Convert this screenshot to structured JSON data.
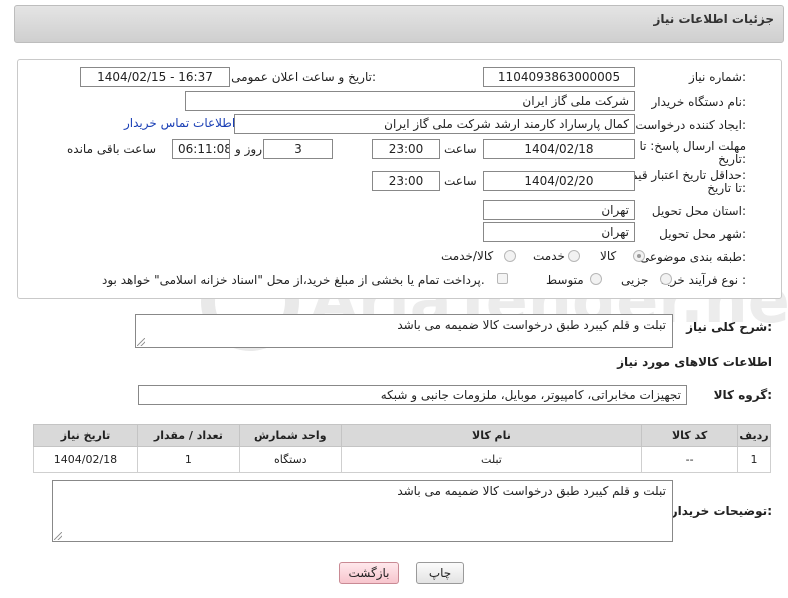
{
  "header": {
    "title": "جزئیات اطلاعات نیاز"
  },
  "form": {
    "need_number_label": "شماره نیاز:",
    "need_number": "1104093863000005",
    "announce_label": "تاریخ و ساعت اعلان عمومی:",
    "announce_value": "1404/02/15 - 16:37",
    "buyer_org_label": "نام دستگاه خریدار:",
    "buyer_org": "شرکت ملی گاز ایران",
    "creator_label": "ایجاد کننده درخواست:",
    "creator": "کمال پارساراد کارمند ارشد شرکت ملی گاز ایران",
    "contact_link": "اطلاعات تماس خریدار",
    "deadline_label_1": "مهلت ارسال پاسخ: تا",
    "deadline_label_2": "تاریخ:",
    "deadline_date": "1404/02/18",
    "time_label": "ساعت",
    "deadline_time": "23:00",
    "days_value": "3",
    "days_label": "روز و",
    "remaining_time": "06:11:08",
    "remaining_label": "ساعت باقی مانده",
    "price_label_1": "حداقل تاریخ اعتبار قیمت:",
    "price_label_2": "تا تاریخ:",
    "price_date": "1404/02/20",
    "price_time": "23:00",
    "province_label": "استان محل تحویل:",
    "province": "تهران",
    "city_label": "شهر محل تحویل:",
    "city": "تهران",
    "category_label": "طبقه بندی موضوعی:",
    "category_options": [
      "کالا",
      "خدمت",
      "کالا/خدمت"
    ],
    "category_selected": "کالا",
    "process_label": "نوع فرآیند خرید :",
    "process_options": [
      "جزیی",
      "متوسط"
    ],
    "payment_note": "پرداخت تمام یا بخشی از مبلغ خرید،از محل \"اسناد خزانه اسلامی\" خواهد بود."
  },
  "description": {
    "label": "شرح کلی نیاز:",
    "text": "تبلت و قلم کیبرد طبق درخواست کالا ضمیمه می باشد"
  },
  "goods": {
    "section_title": "اطلاعات کالاهای مورد نیاز",
    "group_label": "گروه کالا:",
    "group_value": "تجهیزات مخابراتی، کامپیوتر، موبایل، ملزومات جانبی و شبکه",
    "columns": [
      "ردیف",
      "کد کالا",
      "نام کالا",
      "واحد شمارش",
      "تعداد / مقدار",
      "تاریخ نیاز"
    ],
    "rows": [
      [
        "1",
        "--",
        "تبلت",
        "دستگاه",
        "1",
        "1404/02/18"
      ]
    ]
  },
  "buyer_notes": {
    "label": "توضیحات خریدار:",
    "text": "تبلت و قلم کیبرد طبق درخواست کالا ضمیمه می باشد"
  },
  "buttons": {
    "print": "چاپ",
    "back": "بازگشت"
  },
  "watermark": {
    "text": "AriaTender.neT"
  },
  "colors": {
    "link": "#1a3fb5",
    "header_bg": "#d6d6d6",
    "table_header_bg": "#d9d9d9"
  }
}
